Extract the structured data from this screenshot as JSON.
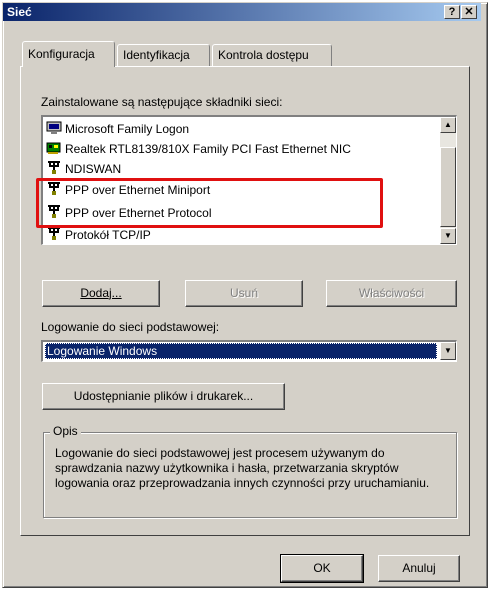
{
  "window": {
    "title": "Sieć",
    "help_glyph": "?",
    "close_glyph": "✕"
  },
  "tabs": [
    {
      "label": "Konfiguracja",
      "active": true
    },
    {
      "label": "Identyfikacja",
      "active": false
    },
    {
      "label": "Kontrola dostępu",
      "active": false
    }
  ],
  "components": {
    "label": "Zainstalowane są następujące składniki sieci:",
    "items": [
      {
        "label": "Microsoft Family Logon",
        "icon": "monitor-icon"
      },
      {
        "label": "Realtek RTL8139/810X Family PCI Fast Ethernet NIC",
        "icon": "network-card-icon"
      },
      {
        "label": "NDISWAN",
        "icon": "protocol-icon"
      },
      {
        "label": "PPP over Ethernet Miniport",
        "icon": "protocol-icon"
      },
      {
        "label": "PPP over Ethernet Protocol",
        "icon": "protocol-icon"
      },
      {
        "label": "Protokół TCP/IP",
        "icon": "protocol-icon"
      }
    ],
    "highlight_color": "#e01010"
  },
  "actions": {
    "add": "Dodaj...",
    "remove": "Usuń",
    "properties": "Właściwości"
  },
  "primary_logon": {
    "label": "Logowanie do sieci podstawowej:",
    "value": "Logowanie Windows"
  },
  "sharing_button": "Udostępnianie plików i drukarek...",
  "description": {
    "title": "Opis",
    "text": "Logowanie do sieci podstawowej jest procesem używanym do sprawdzania nazwy użytkownika i hasła, przetwarzania skryptów logowania oraz przeprowadzania innych czynności przy uruchamianiu."
  },
  "dialog_buttons": {
    "ok": "OK",
    "cancel": "Anuluj"
  },
  "colors": {
    "title_bar": "#0a246a",
    "face": "#d4d0c8",
    "selection": "#0a246a"
  }
}
